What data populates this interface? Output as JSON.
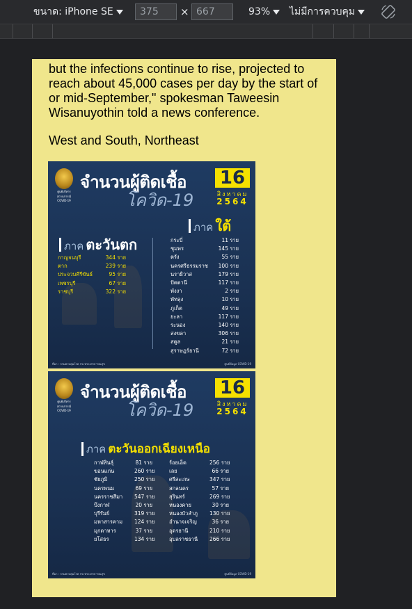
{
  "toolbar": {
    "device_label": "ขนาด: iPhone SE",
    "width": "375",
    "times": "×",
    "height": "667",
    "zoom": "93%",
    "throttle": "ไม่มีการควบคุม",
    "rotate_icon": "rotate-icon"
  },
  "article": {
    "paragraph": "but the infections continue to rise, projected to reach about 45,000 cases per day by the start of or mid-September,\" spokesman Taweesin Wisanuyothin told a news conference.",
    "subheading": "West and South, Northeast"
  },
  "infographic_1": {
    "emblem_text": "ศูนย์บริหารสถานการณ์ COVID-19",
    "title": "จำนวนผู้ติดเชื้อ",
    "subtitle": "โควิด-19",
    "day": "16",
    "month": "สิงหาคม",
    "year": "2564",
    "west": {
      "prefix": "ภาค",
      "name": "ตะวันตก",
      "rows": [
        {
          "province": "กาญจนบุรี",
          "count": "344 ราย"
        },
        {
          "province": "ตาก",
          "count": "239 ราย"
        },
        {
          "province": "ประจวบคีรีขันธ์",
          "count": "95 ราย"
        },
        {
          "province": "เพชรบุรี",
          "count": "67 ราย"
        },
        {
          "province": "ราชบุรี",
          "count": "322 ราย"
        }
      ]
    },
    "south": {
      "prefix": "ภาค",
      "name": "ใต้",
      "rows": [
        {
          "province": "กระบี่",
          "count": "11 ราย"
        },
        {
          "province": "ชุมพร",
          "count": "145 ราย"
        },
        {
          "province": "ตรัง",
          "count": "55 ราย"
        },
        {
          "province": "นครศรีธรรมราช",
          "count": "100 ราย"
        },
        {
          "province": "นราธิวาส",
          "count": "179 ราย"
        },
        {
          "province": "ปัตตานี",
          "count": "117 ราย"
        },
        {
          "province": "พังงา",
          "count": "2 ราย"
        },
        {
          "province": "พัทลุง",
          "count": "10 ราย"
        },
        {
          "province": "ภูเก็ต",
          "count": "49 ราย"
        },
        {
          "province": "ยะลา",
          "count": "117 ราย"
        },
        {
          "province": "ระนอง",
          "count": "140 ราย"
        },
        {
          "province": "สงขลา",
          "count": "306 ราย"
        },
        {
          "province": "สตูล",
          "count": "21 ราย"
        },
        {
          "province": "สุราษฎร์ธานี",
          "count": "72 ราย"
        }
      ]
    },
    "footer_left": "ที่มา : กรมควบคุมโรค กระทรวงสาธารณสุข",
    "footer_right": "ศูนย์ข้อมูล COVID-19"
  },
  "infographic_2": {
    "emblem_text": "ศูนย์บริหารสถานการณ์ COVID-19",
    "title": "จำนวนผู้ติดเชื้อ",
    "subtitle": "โควิด-19",
    "day": "16",
    "month": "สิงหาคม",
    "year": "2564",
    "northeast": {
      "prefix": "ภาค",
      "name": "ตะวันออกเฉียงเหนือ",
      "rows_left": [
        {
          "province": "กาฬสินธุ์",
          "count": "81 ราย"
        },
        {
          "province": "ขอนแก่น",
          "count": "260 ราย"
        },
        {
          "province": "ชัยภูมิ",
          "count": "250 ราย"
        },
        {
          "province": "นครพนม",
          "count": "69 ราย"
        },
        {
          "province": "นครราชสีมา",
          "count": "547 ราย"
        },
        {
          "province": "บึงกาฬ",
          "count": "20 ราย"
        },
        {
          "province": "บุรีรัมย์",
          "count": "319 ราย"
        },
        {
          "province": "มหาสารคาม",
          "count": "124 ราย"
        },
        {
          "province": "มุกดาหาร",
          "count": "37 ราย"
        },
        {
          "province": "ยโสธร",
          "count": "134 ราย"
        }
      ],
      "rows_right": [
        {
          "province": "ร้อยเอ็ด",
          "count": "256 ราย"
        },
        {
          "province": "เลย",
          "count": "66 ราย"
        },
        {
          "province": "ศรีสะเกษ",
          "count": "347 ราย"
        },
        {
          "province": "สกลนคร",
          "count": "57 ราย"
        },
        {
          "province": "สุรินทร์",
          "count": "269 ราย"
        },
        {
          "province": "หนองคาย",
          "count": "30 ราย"
        },
        {
          "province": "หนองบัวลำภู",
          "count": "130 ราย"
        },
        {
          "province": "อำนาจเจริญ",
          "count": "36 ราย"
        },
        {
          "province": "อุดรธานี",
          "count": "210 ราย"
        },
        {
          "province": "อุบลราชธานี",
          "count": "266 ราย"
        }
      ]
    },
    "footer_left": "ที่มา : กรมควบคุมโรค กระทรวงสาธารณสุข",
    "footer_right": "ศูนย์ข้อมูล COVID-19"
  },
  "colors": {
    "page_bg": "#f0e68c",
    "devtools_bg": "#202124",
    "accent_yellow": "#f5e000",
    "info_blue": "#1f3b62"
  }
}
